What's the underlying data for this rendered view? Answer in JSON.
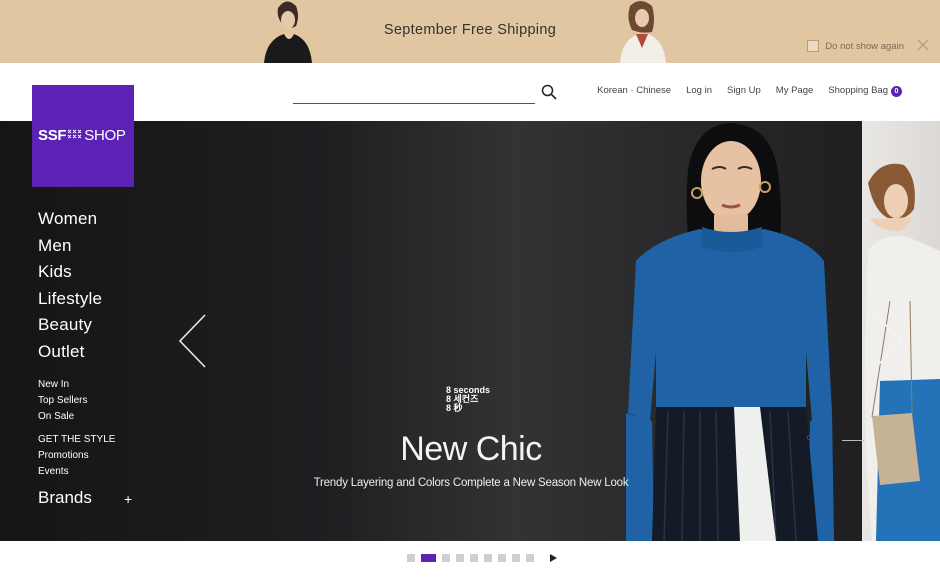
{
  "promo": {
    "text": "September Free Shipping",
    "dont_show_label": "Do not show again"
  },
  "header": {
    "search_placeholder": "",
    "nav": {
      "language": "Korean · Chinese",
      "login": "Log in",
      "signup": "Sign Up",
      "mypage": "My Page",
      "bag": "Shopping Bag",
      "bag_count": "0"
    }
  },
  "logo": {
    "ssf": "SSF",
    "shop": "SHOP"
  },
  "sidebar": {
    "main": [
      "Women",
      "Men",
      "Kids",
      "Lifestyle",
      "Beauty",
      "Outlet"
    ],
    "sub1": [
      "New In",
      "Top Sellers",
      "On Sale"
    ],
    "sub2": [
      "GET THE STYLE",
      "Promotions",
      "Events"
    ],
    "brands": "Brands",
    "brands_toggle": "+"
  },
  "hero": {
    "brand_lines": [
      "8 seconds",
      "8 세컨즈",
      "8 秒"
    ],
    "title": "New Chic",
    "subtitle": "Trendy Layering and Colors Complete a New Season New Look",
    "slide_number": "0"
  },
  "pager": {
    "count": 9,
    "active_index": 1
  },
  "colors": {
    "accent": "#5b22b5",
    "promo_bg": "#e0c7a1",
    "hero_bg": "#1f1f22"
  }
}
